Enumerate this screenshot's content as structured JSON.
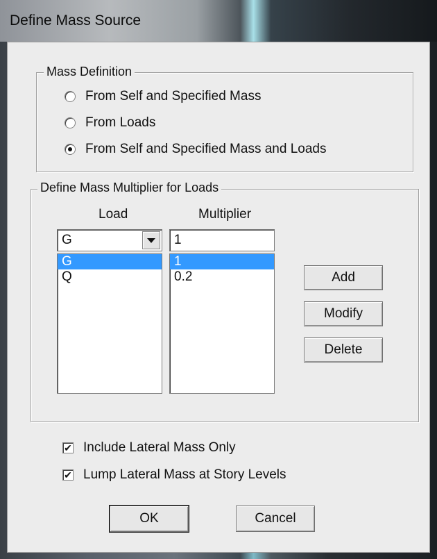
{
  "window": {
    "title": "Define Mass Source"
  },
  "mass_definition": {
    "label": "Mass Definition",
    "options": [
      {
        "label": "From Self and Specified Mass",
        "checked": false
      },
      {
        "label": "From Loads",
        "checked": false
      },
      {
        "label": "From Self and Specified Mass and Loads",
        "checked": true
      }
    ]
  },
  "multiplier_group": {
    "label": "Define Mass Multiplier for Loads",
    "load_header": "Load",
    "multiplier_header": "Multiplier",
    "load_combo_value": "G",
    "multiplier_value": "1",
    "loads": [
      "G",
      "Q"
    ],
    "multipliers": [
      "1",
      "0.2"
    ],
    "selected_index": 0,
    "add_label": "Add",
    "modify_label": "Modify",
    "delete_label": "Delete"
  },
  "options": {
    "include_lateral": {
      "label": "Include Lateral Mass Only",
      "checked": true
    },
    "lump_lateral": {
      "label": "Lump Lateral Mass at Story Levels",
      "checked": true
    }
  },
  "buttons": {
    "ok": "OK",
    "cancel": "Cancel"
  },
  "colors": {
    "selection": "#3399ff",
    "dialog_bg": "#ececec"
  }
}
